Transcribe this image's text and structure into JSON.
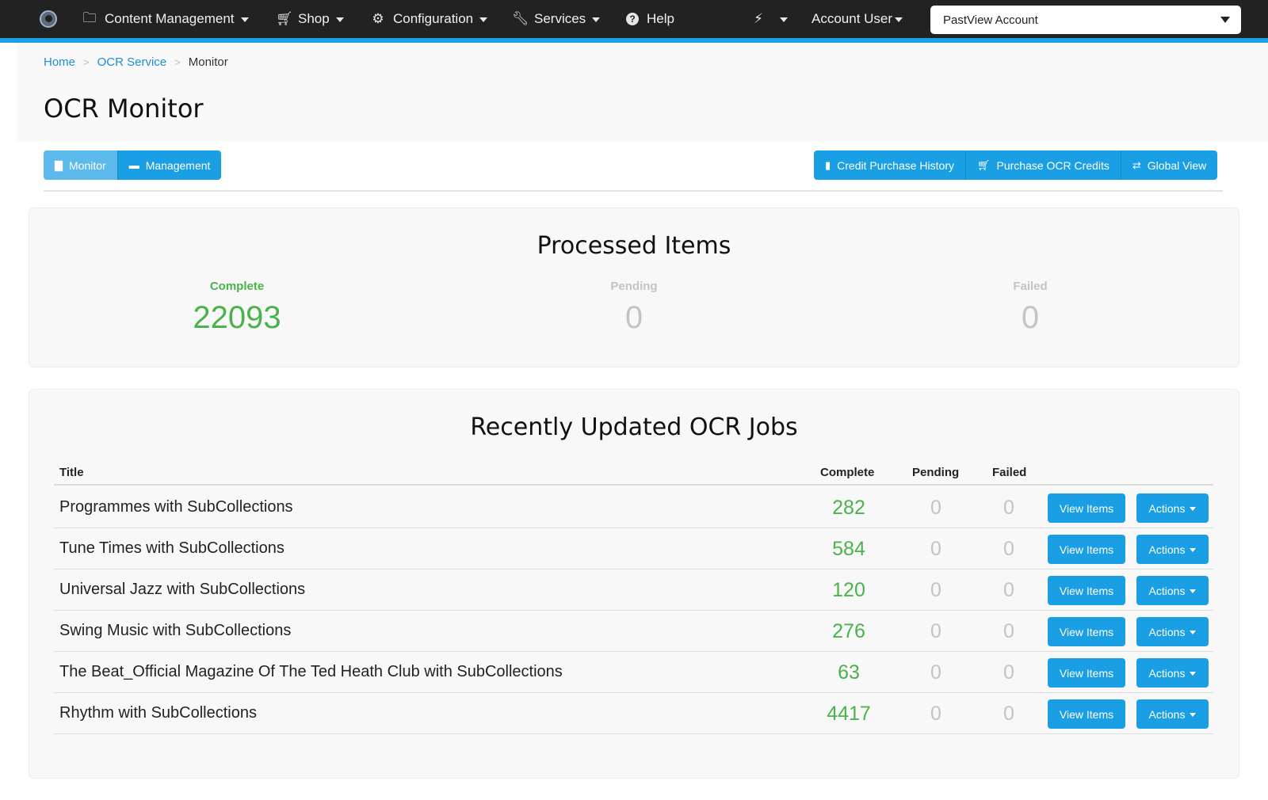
{
  "nav": {
    "logo_icon": "logo-icon",
    "items": [
      {
        "label": "Content Management",
        "icon": "folder-icon"
      },
      {
        "label": "Shop",
        "icon": "cart-icon"
      },
      {
        "label": "Configuration",
        "icon": "gear-icon"
      },
      {
        "label": "Services",
        "icon": "wrench-icon"
      },
      {
        "label": "Help",
        "icon": "question-icon"
      }
    ],
    "bolt_icon": "bolt-icon",
    "account_user": "Account User",
    "account_select": "PastView Account"
  },
  "breadcrumb": {
    "home": "Home",
    "sep": ">",
    "service": "OCR Service",
    "current": "Monitor"
  },
  "page": {
    "title": "OCR Monitor"
  },
  "tabs": {
    "monitor": "Monitor",
    "management": "Management"
  },
  "actions": {
    "credit_history": "Credit Purchase History",
    "purchase_credits": "Purchase OCR Credits",
    "global_view": "Global View"
  },
  "processed": {
    "title": "Processed Items",
    "complete_label": "Complete",
    "complete_value": "22093",
    "pending_label": "Pending",
    "pending_value": "0",
    "failed_label": "Failed",
    "failed_value": "0"
  },
  "jobs": {
    "title": "Recently Updated OCR Jobs",
    "headers": {
      "title": "Title",
      "complete": "Complete",
      "pending": "Pending",
      "failed": "Failed"
    },
    "view_label": "View Items",
    "actions_label": "Actions",
    "rows": [
      {
        "title": "Programmes with SubCollections",
        "complete": "282",
        "pending": "0",
        "failed": "0"
      },
      {
        "title": "Tune Times with SubCollections",
        "complete": "584",
        "pending": "0",
        "failed": "0"
      },
      {
        "title": "Universal Jazz with SubCollections",
        "complete": "120",
        "pending": "0",
        "failed": "0"
      },
      {
        "title": "Swing Music with SubCollections",
        "complete": "276",
        "pending": "0",
        "failed": "0"
      },
      {
        "title": "The Beat_Official Magazine Of The Ted Heath Club with SubCollections",
        "complete": "63",
        "pending": "0",
        "failed": "0"
      },
      {
        "title": "Rhythm with SubCollections",
        "complete": "4417",
        "pending": "0",
        "failed": "0"
      }
    ]
  },
  "colors": {
    "accent": "#1b9fe4",
    "success": "#4bb34b",
    "muted": "#c4c4c4",
    "nav_bg": "#222222"
  }
}
